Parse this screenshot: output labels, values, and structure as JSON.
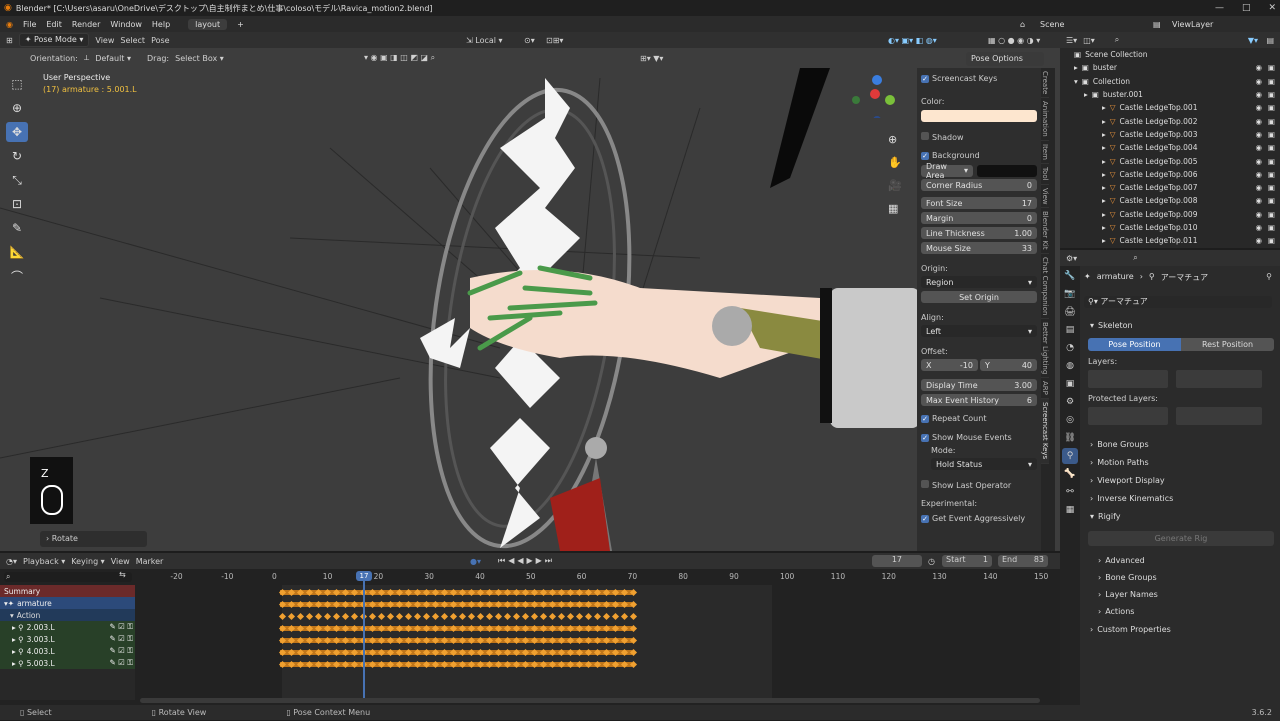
{
  "window": {
    "title": "Blender* [C:\\Users\\asaru\\OneDrive\\デスクトップ\\自主制作まとめ\\仕事\\coloso\\モデル\\Ravica_motion2.blend]",
    "controls": [
      "—",
      "□",
      "✕"
    ]
  },
  "menu": {
    "items": [
      "File",
      "Edit",
      "Render",
      "Window",
      "Help"
    ],
    "workspace_tab": "layout",
    "add_tab": "+",
    "scene_label": "Scene",
    "viewlayer_label": "ViewLayer"
  },
  "viewport_header": {
    "mode": "Pose Mode",
    "view": "View",
    "select": "Select",
    "pose": "Pose",
    "transform_space": "Local",
    "orientation_label": "Orientation:",
    "orientation": "Default",
    "drag_label": "Drag:",
    "drag": "Select Box",
    "pose_options": "Pose Options"
  },
  "viewport": {
    "perspective": "User Perspective",
    "active": "(17) armature : 5.001.L",
    "key_overlay": "Z",
    "last_operator": "Rotate"
  },
  "npanel": {
    "title": "Screencast Keys",
    "color_label": "Color:",
    "shadow": "Shadow",
    "background": "Background",
    "draw_area": "Draw Area",
    "corner_radius": {
      "label": "Corner Radius",
      "value": "0"
    },
    "font_size": {
      "label": "Font Size",
      "value": "17"
    },
    "margin": {
      "label": "Margin",
      "value": "0"
    },
    "line_thickness": {
      "label": "Line Thickness",
      "value": "1.00"
    },
    "mouse_size": {
      "label": "Mouse Size",
      "value": "33"
    },
    "origin_label": "Origin:",
    "origin": "Region",
    "set_origin": "Set Origin",
    "align_label": "Align:",
    "align": "Left",
    "offset_label": "Offset:",
    "offset_x": {
      "label": "X",
      "value": "-10"
    },
    "offset_y": {
      "label": "Y",
      "value": "40"
    },
    "display_time": {
      "label": "Display Time",
      "value": "3.00"
    },
    "max_event_history": {
      "label": "Max Event History",
      "value": "6"
    },
    "repeat_count": "Repeat Count",
    "show_mouse_events": "Show Mouse Events",
    "mode_label": "Mode:",
    "mode": "Hold Status",
    "show_last_operator": "Show Last Operator",
    "experimental_label": "Experimental:",
    "get_event_aggressively": "Get Event Aggressively",
    "colors": {
      "text_color": "#fde6cf",
      "bg_color": "#111111"
    }
  },
  "side_tabs": [
    "Create",
    "Animation",
    "Item",
    "Tool",
    "View",
    "Blender Kit",
    "Chat Companion",
    "Better Lighting",
    "ARP",
    "Screencast Keys"
  ],
  "outliner": {
    "scene_collection": "Scene Collection",
    "items": [
      {
        "label": "buster"
      },
      {
        "label": "Collection"
      },
      {
        "label": "buster.001"
      },
      {
        "label": "Castle LedgeTop.001"
      },
      {
        "label": "Castle LedgeTop.002"
      },
      {
        "label": "Castle LedgeTop.003"
      },
      {
        "label": "Castle LedgeTop.004"
      },
      {
        "label": "Castle LedgeTop.005"
      },
      {
        "label": "Castle LedgeTop.006"
      },
      {
        "label": "Castle LedgeTop.007"
      },
      {
        "label": "Castle LedgeTop.008"
      },
      {
        "label": "Castle LedgeTop.009"
      },
      {
        "label": "Castle LedgeTop.010"
      },
      {
        "label": "Castle LedgeTop.011"
      }
    ]
  },
  "properties": {
    "breadcrumb_object": "armature",
    "breadcrumb_data": "アーマチュア",
    "data_name": "アーマチュア",
    "skeleton": "Skeleton",
    "pose_position": "Pose Position",
    "rest_position": "Rest Position",
    "layers": "Layers:",
    "protected_layers": "Protected Layers:",
    "panels": [
      "Bone Groups",
      "Motion Paths",
      "Viewport Display",
      "Inverse Kinematics"
    ],
    "rigify": "Rigify",
    "generate_rig": "Generate Rig",
    "rigify_sub": [
      "Advanced",
      "Bone Groups",
      "Layer Names",
      "Actions"
    ],
    "custom_properties": "Custom Properties"
  },
  "timeline": {
    "menus": [
      "Playback",
      "Keying",
      "View",
      "Marker"
    ],
    "current_frame": "17",
    "start_label": "Start",
    "start": "1",
    "end_label": "End",
    "end": "83",
    "ruler": [
      "-20",
      "-10",
      "0",
      "10",
      "17",
      "20",
      "30",
      "40",
      "50",
      "60",
      "70",
      "80",
      "90",
      "100",
      "110",
      "120",
      "130",
      "140",
      "150"
    ],
    "channels": [
      "Summary",
      "armature",
      "Action",
      "2.003.L",
      "3.003.L",
      "4.003.L",
      "5.003.L"
    ]
  },
  "status": {
    "select": "Select",
    "rotate_view": "Rotate View",
    "context_menu": "Pose Context Menu",
    "version": "3.6.2"
  }
}
